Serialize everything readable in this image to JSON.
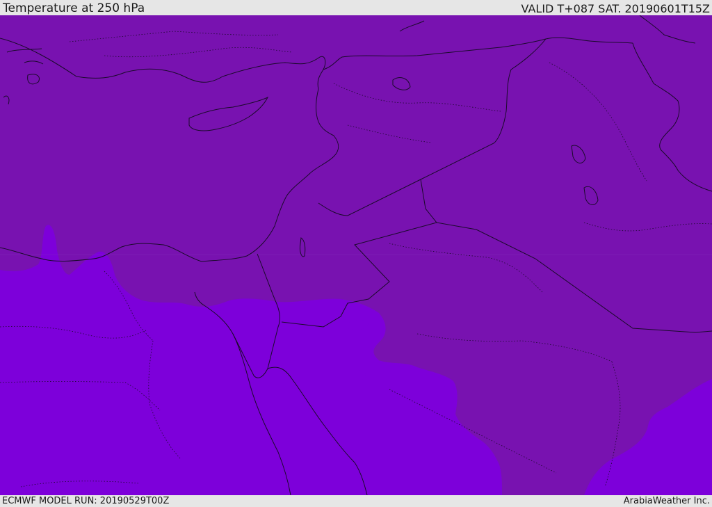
{
  "header": {
    "title": "Temperature at 250 hPa",
    "valid": "VALID T+087 SAT. 20190601T15Z"
  },
  "footer": {
    "model_run": "ECMWF MODEL RUN: 20190529T00Z",
    "provider": "ArabiaWeather Inc."
  },
  "colors": {
    "field_warm": "#7812b0",
    "field_cold": "#7d00da",
    "border_line": "#1a0a2a",
    "background": "#e6e6e6"
  }
}
